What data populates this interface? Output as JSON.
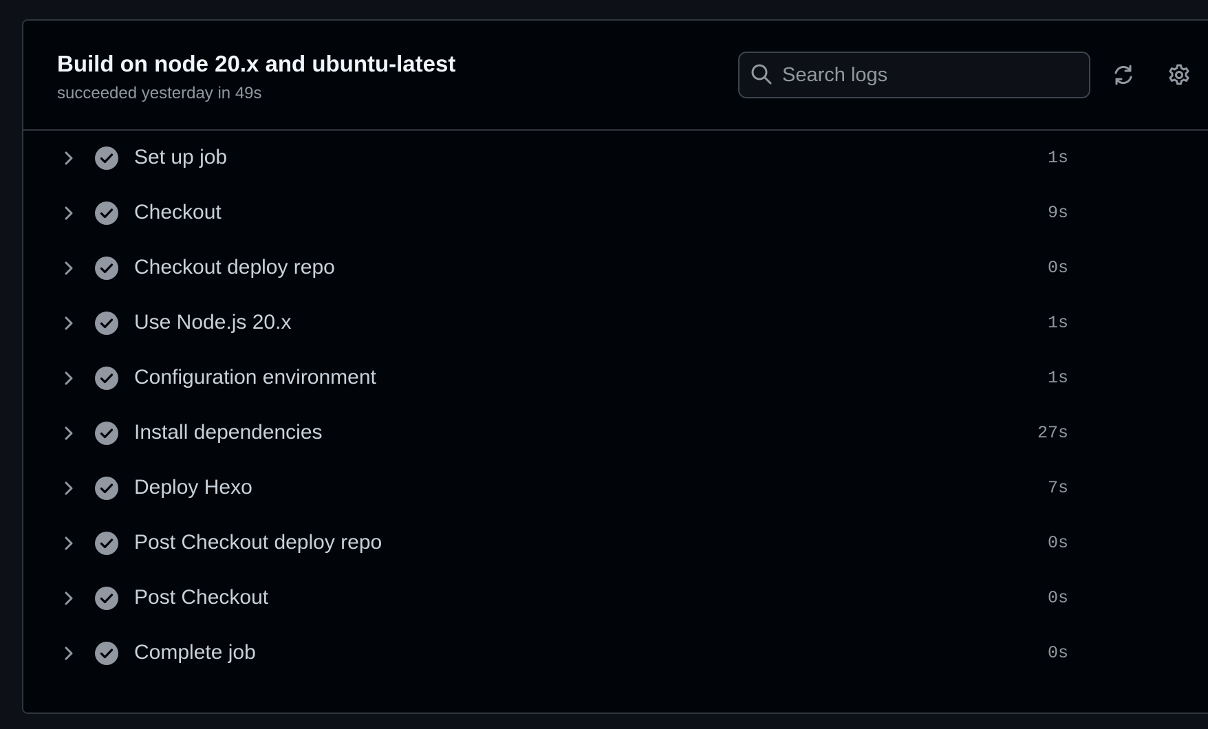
{
  "job": {
    "title": "Build on node 20.x and ubuntu-latest",
    "status_text": "succeeded yesterday in 49s"
  },
  "search": {
    "placeholder": "Search logs",
    "value": ""
  },
  "toolbar": {
    "refresh_icon": "sync-icon",
    "settings_icon": "gear-icon"
  },
  "colors": {
    "background": "#010409",
    "page": "#0d1117",
    "border": "#30363d",
    "title": "#f0f6fc",
    "muted": "#9198a1",
    "step_text": "#c9d1d9",
    "check_fill": "#9198a1"
  },
  "steps": [
    {
      "name": "Set up job",
      "duration": "1s",
      "status": "success"
    },
    {
      "name": "Checkout",
      "duration": "9s",
      "status": "success"
    },
    {
      "name": "Checkout deploy repo",
      "duration": "0s",
      "status": "success"
    },
    {
      "name": "Use Node.js 20.x",
      "duration": "1s",
      "status": "success"
    },
    {
      "name": "Configuration environment",
      "duration": "1s",
      "status": "success"
    },
    {
      "name": "Install dependencies",
      "duration": "27s",
      "status": "success"
    },
    {
      "name": "Deploy Hexo",
      "duration": "7s",
      "status": "success"
    },
    {
      "name": "Post Checkout deploy repo",
      "duration": "0s",
      "status": "success"
    },
    {
      "name": "Post Checkout",
      "duration": "0s",
      "status": "success"
    },
    {
      "name": "Complete job",
      "duration": "0s",
      "status": "success"
    }
  ]
}
